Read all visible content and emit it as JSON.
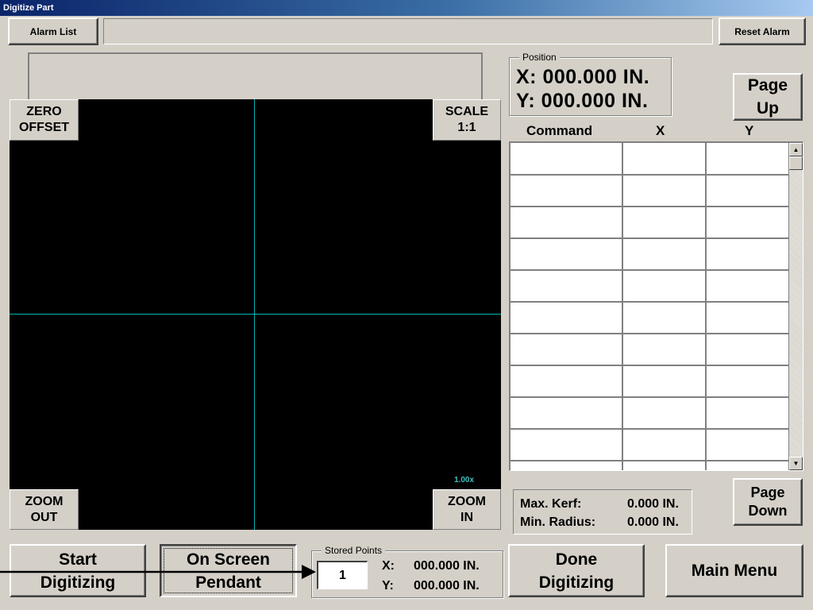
{
  "window": {
    "title": "Digitize Part"
  },
  "toolbar": {
    "alarm_list": "Alarm List",
    "alarm_message": "",
    "reset_alarm": "Reset Alarm"
  },
  "plot": {
    "zero_offset": "ZERO\nOFFSET",
    "scale": "SCALE\n1:1",
    "zoom_out": "ZOOM\nOUT",
    "zoom_in": "ZOOM\nIN",
    "zoom_level": "1.00x",
    "crosshair_color": "#00b4b4",
    "zoom_text_color": "#40c0c0"
  },
  "position": {
    "legend": "Position",
    "x_label": "X:",
    "x_value": "000.000",
    "x_unit": "IN.",
    "y_label": "Y:",
    "y_value": "000.000",
    "y_unit": "IN."
  },
  "command_table": {
    "headers": {
      "command": "Command",
      "x": "X",
      "y": "Y"
    },
    "rows": [
      [
        "",
        "",
        ""
      ],
      [
        "",
        "",
        ""
      ],
      [
        "",
        "",
        ""
      ],
      [
        "",
        "",
        ""
      ],
      [
        "",
        "",
        ""
      ],
      [
        "",
        "",
        ""
      ],
      [
        "",
        "",
        ""
      ],
      [
        "",
        "",
        ""
      ],
      [
        "",
        "",
        ""
      ],
      [
        "",
        "",
        ""
      ],
      [
        "",
        "",
        ""
      ]
    ],
    "scroll_up_icon": "scroll-up-arrow",
    "scroll_down_icon": "scroll-down-arrow"
  },
  "paging": {
    "page_up": "Page\nUp",
    "page_down": "Page\nDown"
  },
  "kerf": {
    "max_kerf_label": "Max. Kerf:",
    "max_kerf_value": "0.000 IN.",
    "min_radius_label": "Min. Radius:",
    "min_radius_value": "0.000 IN."
  },
  "bottom": {
    "start_digitizing": "Start\nDigitizing",
    "on_screen_pendant": "On Screen\nPendant",
    "done_digitizing": "Done\nDigitizing",
    "main_menu": "Main Menu"
  },
  "stored_points": {
    "legend": "Stored Points",
    "index": "1",
    "x_label": "X:",
    "x_value": "000.000 IN.",
    "y_label": "Y:",
    "y_value": "000.000 IN."
  }
}
